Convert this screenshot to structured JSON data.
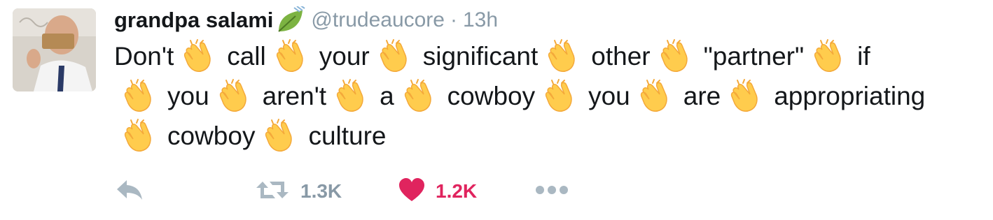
{
  "user": {
    "display_name": "grandpa salami",
    "handle": "@trudeaucore",
    "time": "13h",
    "separator": "·"
  },
  "tweet": {
    "lines": [
      [
        "Don't",
        "clap",
        "call",
        "clap",
        "your",
        "clap",
        "significant",
        "clap",
        "other",
        "clap",
        "\"partner\"",
        "clap",
        "if"
      ],
      [
        "clap",
        "you",
        "clap",
        "aren't",
        "clap",
        "a",
        "clap",
        "cowboy",
        "clap",
        "you",
        "clap",
        "are",
        "clap",
        "appropriating"
      ],
      [
        "clap",
        "cowboy",
        "clap",
        "culture"
      ]
    ]
  },
  "actions": {
    "retweet_count": "1.3K",
    "like_count": "1.2K"
  },
  "colors": {
    "like": "#e0245e",
    "muted": "#8899a6",
    "clap": "#ffcc4d"
  },
  "icons": [
    "leaf-icon",
    "clap-emoji-icon",
    "reply-icon",
    "retweet-icon",
    "heart-icon",
    "more-icon"
  ]
}
